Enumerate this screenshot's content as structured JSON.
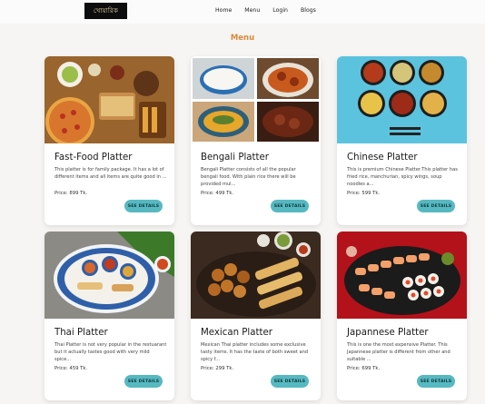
{
  "nav": {
    "logo_text": "খোয়ারিক",
    "links": [
      "Home",
      "Menu",
      "Login",
      "Blogs"
    ]
  },
  "page": {
    "title": "Menu"
  },
  "cards": [
    {
      "title": "Fast-Food Platter",
      "description": "This platter is for family package. It has a lot of different items and all items are quite good in ...",
      "price": "Price: 899 Tk.",
      "button": "SEE DETAILS"
    },
    {
      "title": "Bengali Platter",
      "description": "Bengali Platter consists of all the popular bengali food. With plain rice there will be provided mul...",
      "price": "Price: 499 Tk.",
      "button": "SEE DETAILS"
    },
    {
      "title": "Chinese Platter",
      "description": "This is premium Chinese Platter.This platter has fried rice, manchurian, spicy wings, soup noodles a...",
      "price": "Price: 599 Tk.",
      "button": "SEE DETAILS"
    },
    {
      "title": "Thai Platter",
      "description": "Thai Platter is not very popular in the restuarant but it actually tastes good with very mild spice...",
      "price": "Price: 459 Tk.",
      "button": "SEE DETAILS"
    },
    {
      "title": "Mexican Platter",
      "description": "Mexican Thai platter includes some exclusive tasty items. It has the taste of both sweet and spicy f...",
      "price": "Price: 299 Tk.",
      "button": "SEE DETAILS"
    },
    {
      "title": "Japannese Platter",
      "description": "This is one the most expensive Platter. This Japannese platter is different from other and suitable ...",
      "price": "Price: 699 Tk.",
      "button": "SEE DETAILS"
    }
  ],
  "colors": {
    "accent": "#d98a3a",
    "button": "#56b9c1",
    "background": "#f7f5f3"
  }
}
